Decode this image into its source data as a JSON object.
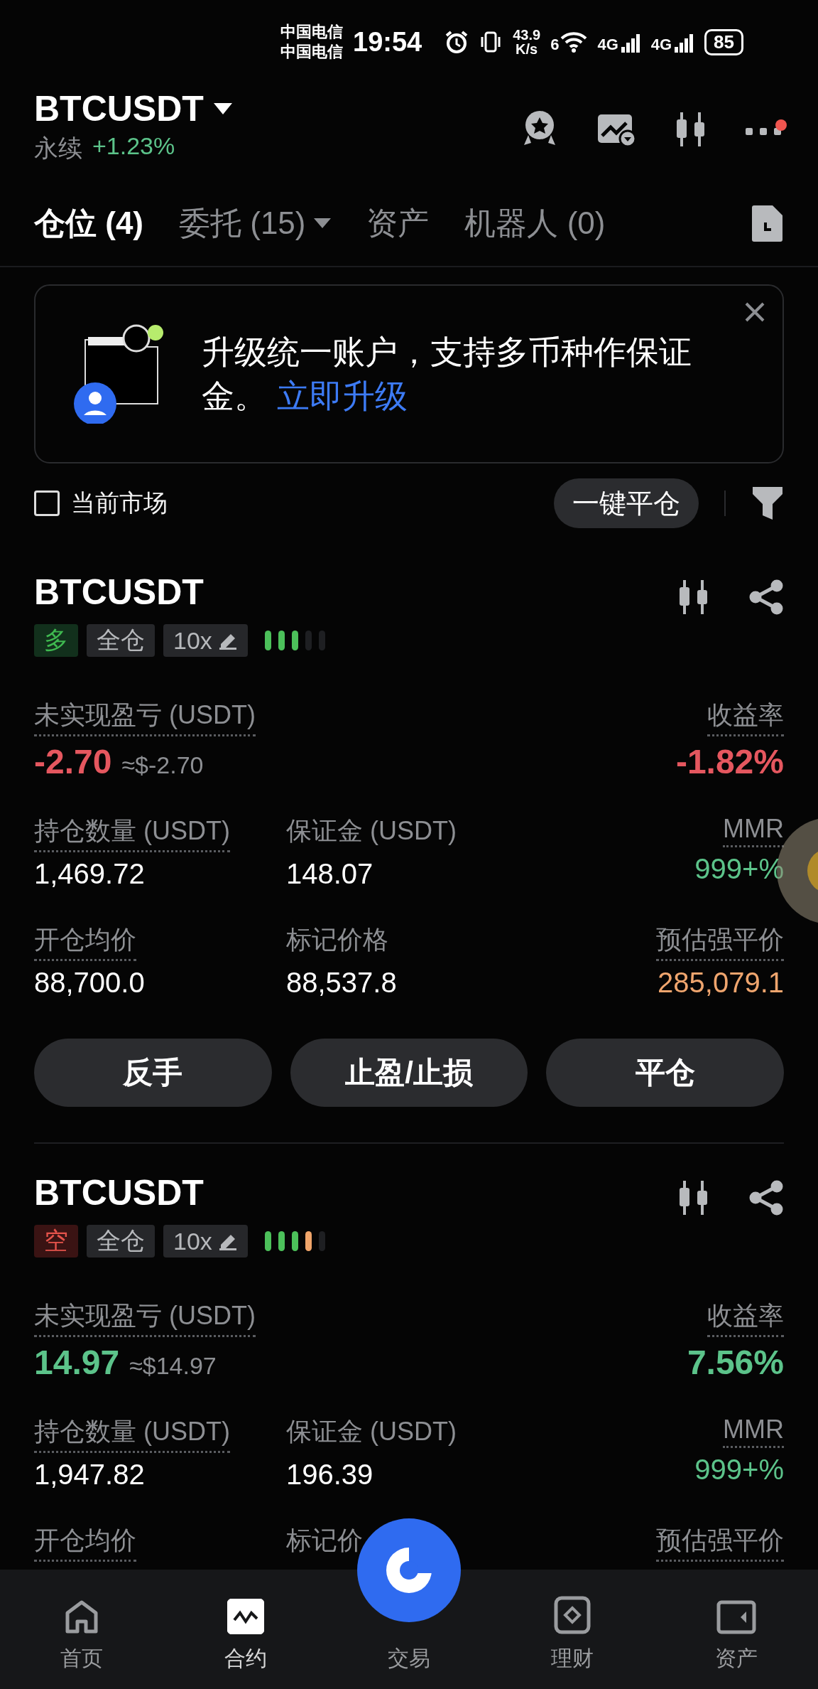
{
  "status_bar": {
    "carriers": [
      "中国电信",
      "中国电信"
    ],
    "time": "19:54",
    "speed": "43.9",
    "speed_unit": "K/s",
    "wifi_label": "6",
    "networks": [
      "4G",
      "4G"
    ],
    "battery": "85"
  },
  "header": {
    "symbol": "BTCUSDT",
    "type": "永续",
    "change": "+1.23%",
    "has_notification": true
  },
  "tabs": [
    {
      "label": "仓位 (4)",
      "selected": true,
      "has_caret": false
    },
    {
      "label": "委托 (15)",
      "selected": false,
      "has_caret": true
    },
    {
      "label": "资产",
      "selected": false,
      "has_caret": false
    },
    {
      "label": "机器人 (0)",
      "selected": false,
      "has_caret": false
    }
  ],
  "banner": {
    "text": "升级统一账户，支持多币种作保证金。",
    "link": "立即升级"
  },
  "filter_row": {
    "checkbox": {
      "label": "当前市场",
      "checked": false
    },
    "close_all": "一键平仓"
  },
  "positions": [
    {
      "symbol": "BTCUSDT",
      "side": {
        "label": "多",
        "kind": "long"
      },
      "margin_mode": "全仓",
      "leverage": "10x",
      "risk_bars": [
        {
          "color": "#4cc05a"
        },
        {
          "color": "#4cc05a"
        },
        {
          "color": "#4cc05a"
        },
        {
          "color": "#1e1f22"
        },
        {
          "color": "#1e1f22"
        }
      ],
      "pnl": {
        "label": "未实现盈亏 (USDT)",
        "value": "-2.70",
        "usd": "≈$-2.70",
        "color": "#e5575f"
      },
      "roi": {
        "label": "收益率",
        "value": "-1.82%",
        "color": "#e5575f"
      },
      "rows": [
        [
          {
            "label": "持仓数量 (USDT)",
            "dotted": true,
            "value": "1,469.72",
            "color": "#ffffff"
          },
          {
            "label": "保证金 (USDT)",
            "dotted": false,
            "value": "148.07",
            "color": "#ffffff"
          },
          {
            "label": "MMR",
            "dotted": true,
            "value": "999+%",
            "color": "#5cc38a"
          }
        ],
        [
          {
            "label": "开仓均价",
            "dotted": true,
            "value": "88,700.0",
            "color": "#ffffff"
          },
          {
            "label": "标记价格",
            "dotted": false,
            "value": "88,537.8",
            "color": "#ffffff"
          },
          {
            "label": "预估强平价",
            "dotted": true,
            "value": "285,079.1",
            "color": "#efa56e"
          }
        ]
      ],
      "actions": [
        "反手",
        "止盈/止损",
        "平仓"
      ]
    },
    {
      "symbol": "BTCUSDT",
      "side": {
        "label": "空",
        "kind": "short"
      },
      "margin_mode": "全仓",
      "leverage": "10x",
      "risk_bars": [
        {
          "color": "#4cc05a"
        },
        {
          "color": "#4cc05a"
        },
        {
          "color": "#4cc05a"
        },
        {
          "color": "#f0a56a"
        },
        {
          "color": "#1e1f22"
        }
      ],
      "pnl": {
        "label": "未实现盈亏 (USDT)",
        "value": "14.97",
        "usd": "≈$14.97",
        "color": "#5cc38a"
      },
      "roi": {
        "label": "收益率",
        "value": "7.56%",
        "color": "#5cc38a"
      },
      "rows": [
        [
          {
            "label": "持仓数量 (USDT)",
            "dotted": true,
            "value": "1,947.82",
            "color": "#ffffff"
          },
          {
            "label": "保证金 (USDT)",
            "dotted": false,
            "value": "196.39",
            "color": "#ffffff"
          },
          {
            "label": "MMR",
            "dotted": true,
            "value": "999+%",
            "color": "#5cc38a"
          }
        ],
        [
          {
            "label": "开仓均价",
            "dotted": true
          },
          {
            "label": "标记价",
            "dotted": false
          },
          {
            "label": "预估强平价",
            "dotted": true
          }
        ]
      ]
    }
  ],
  "bottom_nav": [
    {
      "label": "首页",
      "kind": "home",
      "selected": false
    },
    {
      "label": "合约",
      "kind": "futures",
      "selected": true
    },
    {
      "label": "交易",
      "kind": "trade",
      "selected": false
    },
    {
      "label": "理财",
      "kind": "earn",
      "selected": false
    },
    {
      "label": "资产",
      "kind": "assets",
      "selected": false
    }
  ]
}
